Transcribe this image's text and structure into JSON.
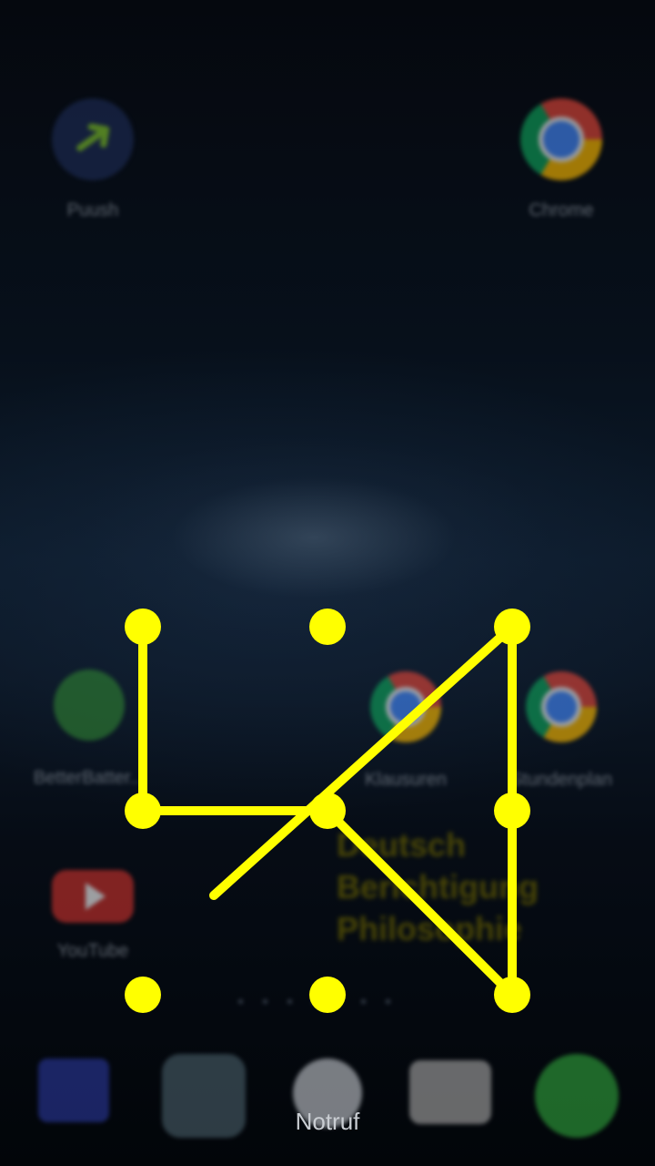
{
  "home_screen": {
    "top_apps": [
      {
        "label": "Puush",
        "icon": "puush-arrow-icon"
      },
      {
        "label": "Chrome",
        "icon": "chrome-icon"
      }
    ],
    "middle_apps": [
      {
        "label": "BetterBatter...",
        "icon": "battery-app-icon"
      },
      {
        "label": "Klausuren",
        "icon": "chrome-icon"
      },
      {
        "label": "Stundenplan",
        "icon": "chrome-icon"
      }
    ],
    "youtube": {
      "label": "YouTube",
      "icon": "youtube-icon"
    },
    "schedule_widget": [
      "Deutsch",
      "Berichtigung",
      "Philosophie"
    ],
    "dock": [
      {
        "icon": "messages-icon"
      },
      {
        "icon": "fx-calculator-icon"
      },
      {
        "icon": "app-drawer-icon"
      },
      {
        "icon": "camera-icon"
      },
      {
        "icon": "whatsapp-icon"
      }
    ]
  },
  "lock_pattern": {
    "dot_count": 9,
    "color": "#ffff00"
  },
  "emergency_call_label": "Notruf"
}
